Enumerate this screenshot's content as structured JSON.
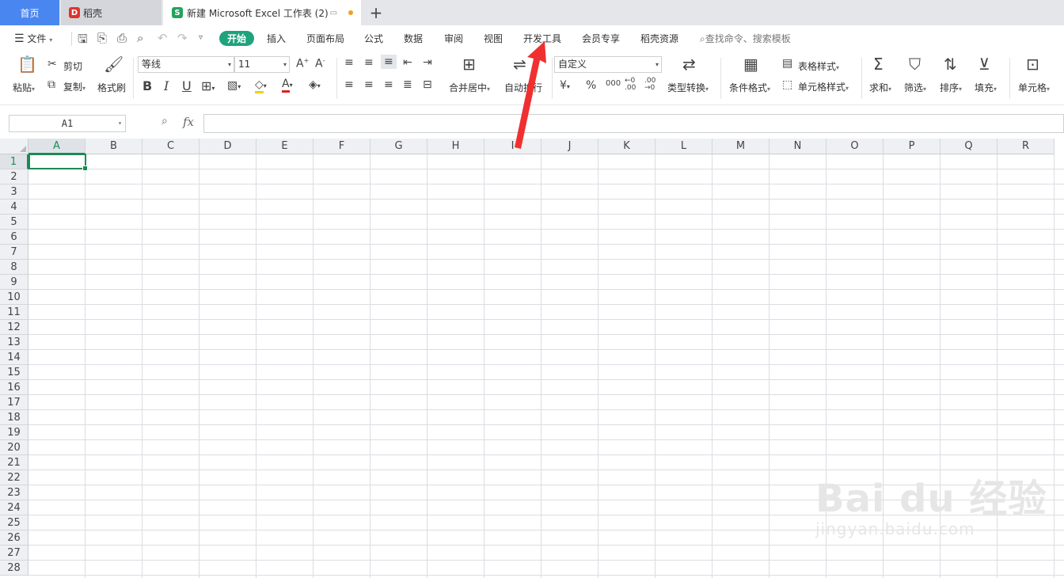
{
  "tabs": {
    "home": "首页",
    "daoke": "稻壳",
    "workbook": "新建 Microsoft Excel 工作表 (2)",
    "add": "+"
  },
  "menu": {
    "file": "文件",
    "items": [
      "开始",
      "插入",
      "页面布局",
      "公式",
      "数据",
      "审阅",
      "视图",
      "开发工具",
      "会员专享",
      "稻壳资源"
    ],
    "search_placeholder": "查找命令、搜索模板"
  },
  "ribbon": {
    "paste": "粘贴",
    "cut": "剪切",
    "copy": "复制",
    "format_painter": "格式刷",
    "font_name": "等线",
    "font_size": "11",
    "merge_center": "合并居中",
    "auto_wrap": "自动换行",
    "number_format": "自定义",
    "type_convert": "类型转换",
    "cond_format": "条件格式",
    "table_style": "表格样式",
    "cell_style": "单元格样式",
    "sum": "求和",
    "filter": "筛选",
    "sort": "排序",
    "fill": "填充",
    "cell": "单元格",
    "bold": "B",
    "italic": "I",
    "underline": "U",
    "currency": "¥",
    "percent": "%",
    "thousands": "000",
    "inc_decimal": "←0 .00",
    "dec_decimal": ".00 →0"
  },
  "formula_bar": {
    "name_box": "A1",
    "fx": "fx",
    "value": ""
  },
  "sheet": {
    "columns": [
      "A",
      "B",
      "C",
      "D",
      "E",
      "F",
      "G",
      "H",
      "I",
      "J",
      "K",
      "L",
      "M",
      "N",
      "O",
      "P",
      "Q",
      "R"
    ],
    "rows": [
      "1",
      "2",
      "3",
      "4",
      "5",
      "6",
      "7",
      "8",
      "9",
      "10",
      "11",
      "12",
      "13",
      "14",
      "15",
      "16",
      "17",
      "18",
      "19",
      "20",
      "21",
      "22",
      "23",
      "24",
      "25",
      "26",
      "27",
      "28"
    ],
    "active_cell": "A1"
  },
  "watermark": {
    "brand": "Bai du 经验",
    "url": "jingyan.baidu.com"
  },
  "colors": {
    "accent_green": "#1d8a55",
    "start_pill": "#1ea37b",
    "home_tab": "#4a86f0",
    "arrow": "#f03030"
  }
}
